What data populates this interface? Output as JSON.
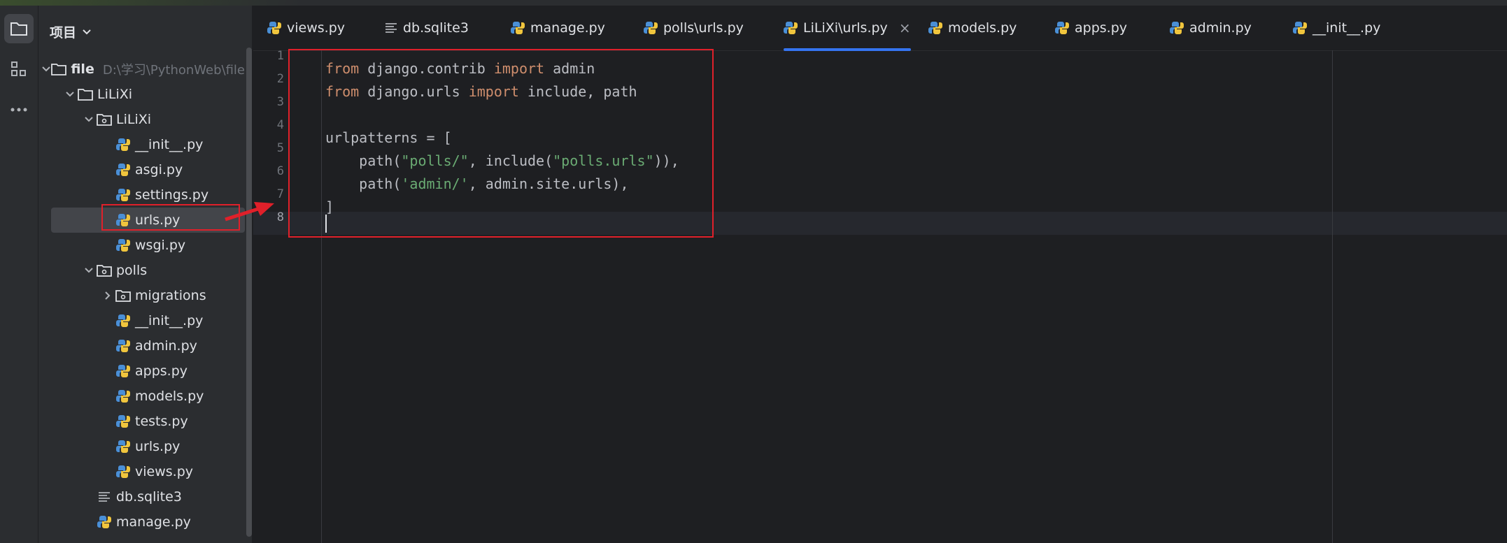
{
  "sidebar": {
    "title": "项目",
    "tree": [
      {
        "label": "file",
        "path": "D:\\学习\\PythonWeb\\file",
        "icon": "folder-icon"
      },
      {
        "label": "LiLiXi",
        "icon": "folder-icon"
      },
      {
        "label": "LiLiXi",
        "icon": "package-icon"
      },
      {
        "label": "__init__.py",
        "icon": "python-file-icon"
      },
      {
        "label": "asgi.py",
        "icon": "python-file-icon"
      },
      {
        "label": "settings.py",
        "icon": "python-file-icon"
      },
      {
        "label": "urls.py",
        "icon": "python-file-icon",
        "selected": true
      },
      {
        "label": "wsgi.py",
        "icon": "python-file-icon"
      },
      {
        "label": "polls",
        "icon": "package-icon"
      },
      {
        "label": "migrations",
        "icon": "package-icon"
      },
      {
        "label": "__init__.py",
        "icon": "python-file-icon"
      },
      {
        "label": "admin.py",
        "icon": "python-file-icon"
      },
      {
        "label": "apps.py",
        "icon": "python-file-icon"
      },
      {
        "label": "models.py",
        "icon": "python-file-icon"
      },
      {
        "label": "tests.py",
        "icon": "python-file-icon"
      },
      {
        "label": "urls.py",
        "icon": "python-file-icon"
      },
      {
        "label": "views.py",
        "icon": "python-file-icon"
      },
      {
        "label": "db.sqlite3",
        "icon": "text-file-icon"
      },
      {
        "label": "manage.py",
        "icon": "python-file-icon"
      }
    ]
  },
  "tabs": [
    {
      "label": "views.py",
      "icon": "python-file-icon"
    },
    {
      "label": "db.sqlite3",
      "icon": "text-file-icon"
    },
    {
      "label": "manage.py",
      "icon": "python-file-icon"
    },
    {
      "label": "polls\\urls.py",
      "icon": "python-file-icon"
    },
    {
      "label": "LiLiXi\\urls.py",
      "icon": "python-file-icon",
      "active": true,
      "close": "×"
    },
    {
      "label": "models.py",
      "icon": "python-file-icon"
    },
    {
      "label": "apps.py",
      "icon": "python-file-icon"
    },
    {
      "label": "admin.py",
      "icon": "python-file-icon"
    },
    {
      "label": "__init__.py",
      "icon": "python-file-icon"
    }
  ],
  "editor": {
    "line_numbers": [
      "1",
      "2",
      "3",
      "4",
      "5",
      "6",
      "7",
      "8"
    ],
    "current_line": 8,
    "lines": [
      [
        {
          "t": "from",
          "c": "kw"
        },
        {
          "t": " django.contrib "
        },
        {
          "t": "import",
          "c": "kw"
        },
        {
          "t": " admin"
        }
      ],
      [
        {
          "t": "from",
          "c": "kw"
        },
        {
          "t": " django.urls "
        },
        {
          "t": "import",
          "c": "kw"
        },
        {
          "t": " include, path"
        }
      ],
      [],
      [
        {
          "t": "urlpatterns = ["
        }
      ],
      [
        {
          "t": "    path("
        },
        {
          "t": "\"polls/\"",
          "c": "str"
        },
        {
          "t": ", include("
        },
        {
          "t": "\"polls.urls\"",
          "c": "str"
        },
        {
          "t": ")),"
        }
      ],
      [
        {
          "t": "    path("
        },
        {
          "t": "'admin/'",
          "c": "str"
        },
        {
          "t": ", admin.site.urls),"
        }
      ],
      [
        {
          "t": "]"
        }
      ],
      []
    ]
  },
  "colors": {
    "keyword": "#cf8e6d",
    "string": "#6aab73",
    "highlight_box": "#e0202a",
    "tab_accent": "#3574f0"
  }
}
